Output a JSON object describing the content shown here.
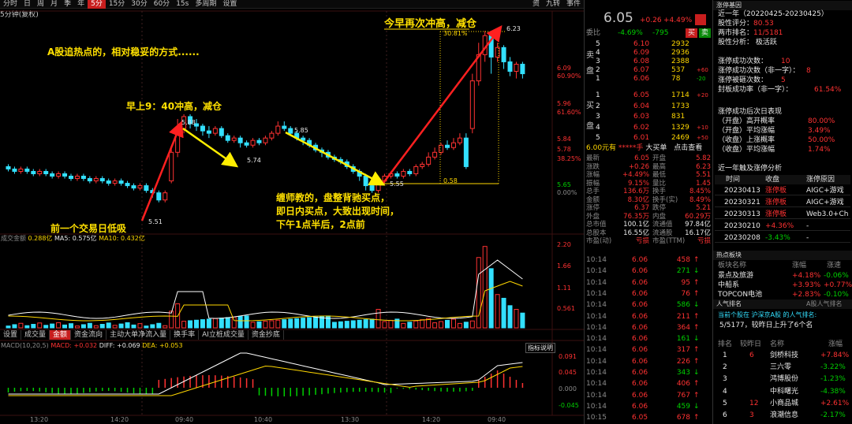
{
  "toolbar": {
    "periods": [
      "分时",
      "日",
      "周",
      "月",
      "季",
      "年",
      "5分",
      "15分",
      "30分",
      "60分",
      "15s",
      "多周期",
      "设置"
    ],
    "active": "5分",
    "right_items": [
      "资",
      "九转",
      "事件"
    ]
  },
  "sub": {
    "label": "5分钟(复权)"
  },
  "annotations": {
    "a1": "A股追热点的，相对稳妥的方式......",
    "a2": "早上9：40冲高，减仓",
    "a3": "今早再次冲高，减仓",
    "a4": "缠师教的，盘整背驰买点，",
    "a5": "即日内买点，大致出现时间，",
    "a6": "下午1点半后，2点前",
    "a7": "前一个交易日低吸"
  },
  "price_labels": {
    "p585": "5.85",
    "p588": "5.88",
    "p574": "5.74",
    "p555": "5.55",
    "p551": "5.51",
    "p623": "6.23",
    "p058": "0.58",
    "p3081": "30.81%"
  },
  "price_axis": [
    "6.09",
    "5.96",
    "5.84",
    "5.78",
    "5.65"
  ],
  "pct_axis": [
    "60.90%",
    "61.60%",
    "50.00%",
    "38.25%",
    "0.00%"
  ],
  "vol_header": {
    "name": "成交金额",
    "val": "0.288亿",
    "ma5": "MA5: 0.575亿",
    "ma10": "MA10: 0.432亿"
  },
  "vol_axis": [
    "2.20",
    "1.66",
    "1.11",
    "0.561"
  ],
  "tabs": [
    "设置",
    "成交量",
    "金额",
    "资金流向",
    "主动大单净流入量",
    "换手率",
    "AI立桩成交量",
    "资金抄底"
  ],
  "tabs_active": "金额",
  "macd_header": {
    "title": "MACD(10,20,5)",
    "macd": "MACD: +0.032",
    "diff": "DIFF: +0.069",
    "dea": "DEA: +0.053",
    "btn": "指标说明"
  },
  "macd_axis": [
    "0.091",
    "0.045",
    "0.000",
    "-0.045"
  ],
  "time_axis": [
    "13:20",
    "14:20",
    "09:40",
    "10:40",
    "13:30",
    "14:20",
    "09:40"
  ],
  "quote": {
    "price": "6.05",
    "chg": "+0.26",
    "pct": "+4.49%",
    "weibi": "委比",
    "wb1": "-4.69%",
    "wb2": "-795",
    "buy": "买",
    "sell": "卖",
    "asks": [
      [
        "5",
        "6.10",
        "2932",
        ""
      ],
      [
        "4",
        "6.09",
        "2936",
        ""
      ],
      [
        "3",
        "6.08",
        "2388",
        ""
      ],
      [
        "2",
        "6.07",
        "537",
        "+60"
      ],
      [
        "1",
        "6.06",
        "78",
        "-20"
      ]
    ],
    "bids": [
      [
        "1",
        "6.05",
        "1714",
        "+20"
      ],
      [
        "2",
        "6.04",
        "1733",
        ""
      ],
      [
        "3",
        "6.03",
        "831",
        ""
      ],
      [
        "4",
        "6.02",
        "1329",
        "+10"
      ],
      [
        "5",
        "6.01",
        "2469",
        "+50"
      ]
    ],
    "ask_label": "卖",
    "bid_label": "买",
    "pan": "盘"
  },
  "stats_header": {
    "a": "6.00元有",
    "b": "*****手",
    "c": "大买单",
    "d": "点击查看"
  },
  "stats": [
    [
      "最新",
      "6.05",
      "开盘",
      "5.82"
    ],
    [
      "涨跌",
      "+0.26",
      "最高",
      "6.23"
    ],
    [
      "涨幅",
      "+4.49%",
      "最低",
      "5.51"
    ],
    [
      "振幅",
      "9.15%",
      "量比",
      "1.45"
    ],
    [
      "总手",
      "136.6万",
      "换手",
      "8.45%"
    ],
    [
      "金额",
      "8.30亿",
      "换手(实)",
      "8.49%"
    ],
    [
      "涨停",
      "6.37",
      "跌停",
      "5.21"
    ],
    [
      "外盘",
      "76.35万",
      "内盘",
      "60.29万"
    ],
    [
      "总市值",
      "100.1亿",
      "流通值",
      "97.84亿"
    ],
    [
      "总股本",
      "16.55亿",
      "流通股",
      "16.17亿"
    ],
    [
      "市盈(动)",
      "亏损",
      "市盈(TTM)",
      "亏损"
    ]
  ],
  "ticks": [
    [
      "10:14",
      "6.06",
      "458"
    ],
    [
      "10:14",
      "6.06",
      "271"
    ],
    [
      "10:14",
      "6.06",
      "95"
    ],
    [
      "10:14",
      "6.06",
      "76"
    ],
    [
      "10:14",
      "6.06",
      "586"
    ],
    [
      "10:14",
      "6.06",
      "211"
    ],
    [
      "10:14",
      "6.06",
      "364"
    ],
    [
      "10:14",
      "6.06",
      "161"
    ],
    [
      "10:14",
      "6.06",
      "317"
    ],
    [
      "10:14",
      "6.06",
      "226"
    ],
    [
      "10:14",
      "6.06",
      "343"
    ],
    [
      "10:14",
      "6.06",
      "406"
    ],
    [
      "10:14",
      "6.06",
      "767"
    ],
    [
      "10:14",
      "6.06",
      "459"
    ],
    [
      "10:15",
      "6.05",
      "678"
    ]
  ],
  "panel": {
    "title": "涨停基因",
    "period": "近一年（20220425-20230425）",
    "score_l": "股性评分：",
    "score": "80.53",
    "rank_l": "两市排名：",
    "rank": "11/5181",
    "analysis": "股性分析： 极活跃",
    "zt": [
      [
        "涨停成功次数：",
        "10"
      ],
      [
        "涨停成功次数（非一字）：",
        "8"
      ],
      [
        "涨停被砸次数：",
        "5"
      ],
      [
        "封板成功率（非一字）：",
        "61.54%"
      ]
    ],
    "after": "涨停成功后次日表现",
    "after_rows": [
      [
        "（开盘）高开概率",
        "80.00%"
      ],
      [
        "（开盘）平均涨幅",
        "3.49%"
      ],
      [
        "（收盘）上涨概率",
        "50.00%"
      ],
      [
        "（收盘）平均涨幅",
        "1.74%"
      ]
    ],
    "recent": "近一年触及涨停分析",
    "recent_head": [
      "时间",
      "收盘",
      "涨停原因"
    ],
    "recent_rows": [
      [
        "20230413",
        "涨停板",
        "AIGC+游戏"
      ],
      [
        "20230321",
        "涨停板",
        "AIGC+游戏"
      ],
      [
        "20230313",
        "涨停板",
        "Web3.0+Ch"
      ],
      [
        "20230210",
        "+4.36%",
        "-"
      ],
      [
        "20230208",
        "-3.43%",
        "-"
      ]
    ],
    "sector_title": "热点板块",
    "sector_head": [
      "板块名称",
      "涨幅",
      "涨速"
    ],
    "sectors": [
      [
        "景点及旅游",
        "+4.18%",
        "-0.06%"
      ],
      [
        "中船系",
        "+3.93%",
        "+0.77%"
      ],
      [
        "TOPCON电池",
        "+2.83%",
        "-0.10%"
      ]
    ],
    "pop_title": "人气排名",
    "pop_sub": "A股人气排名",
    "pop_hint": "当前个股在 沪深京A股 的人气排名:",
    "pop_rank": "5/5177，较昨日上升了6个名",
    "pop_head": [
      "排名",
      "较昨日",
      "名称",
      "涨幅"
    ],
    "pops": [
      [
        "1",
        "6",
        "剑桥科技",
        "+7.84%"
      ],
      [
        "2",
        "",
        "三六零",
        "-3.22%"
      ],
      [
        "3",
        "",
        "鸿博股份",
        "-1.23%"
      ],
      [
        "4",
        "",
        "中科曙光",
        "-4.38%"
      ],
      [
        "5",
        "12",
        "小商品城",
        "+2.61%"
      ],
      [
        "6",
        "3",
        "浪潮信息",
        "-2.17%"
      ]
    ]
  },
  "colors": {
    "up": "#ff3232",
    "down": "#00d000",
    "yellow": "#ffd700",
    "cyan": "#33e0ff"
  }
}
